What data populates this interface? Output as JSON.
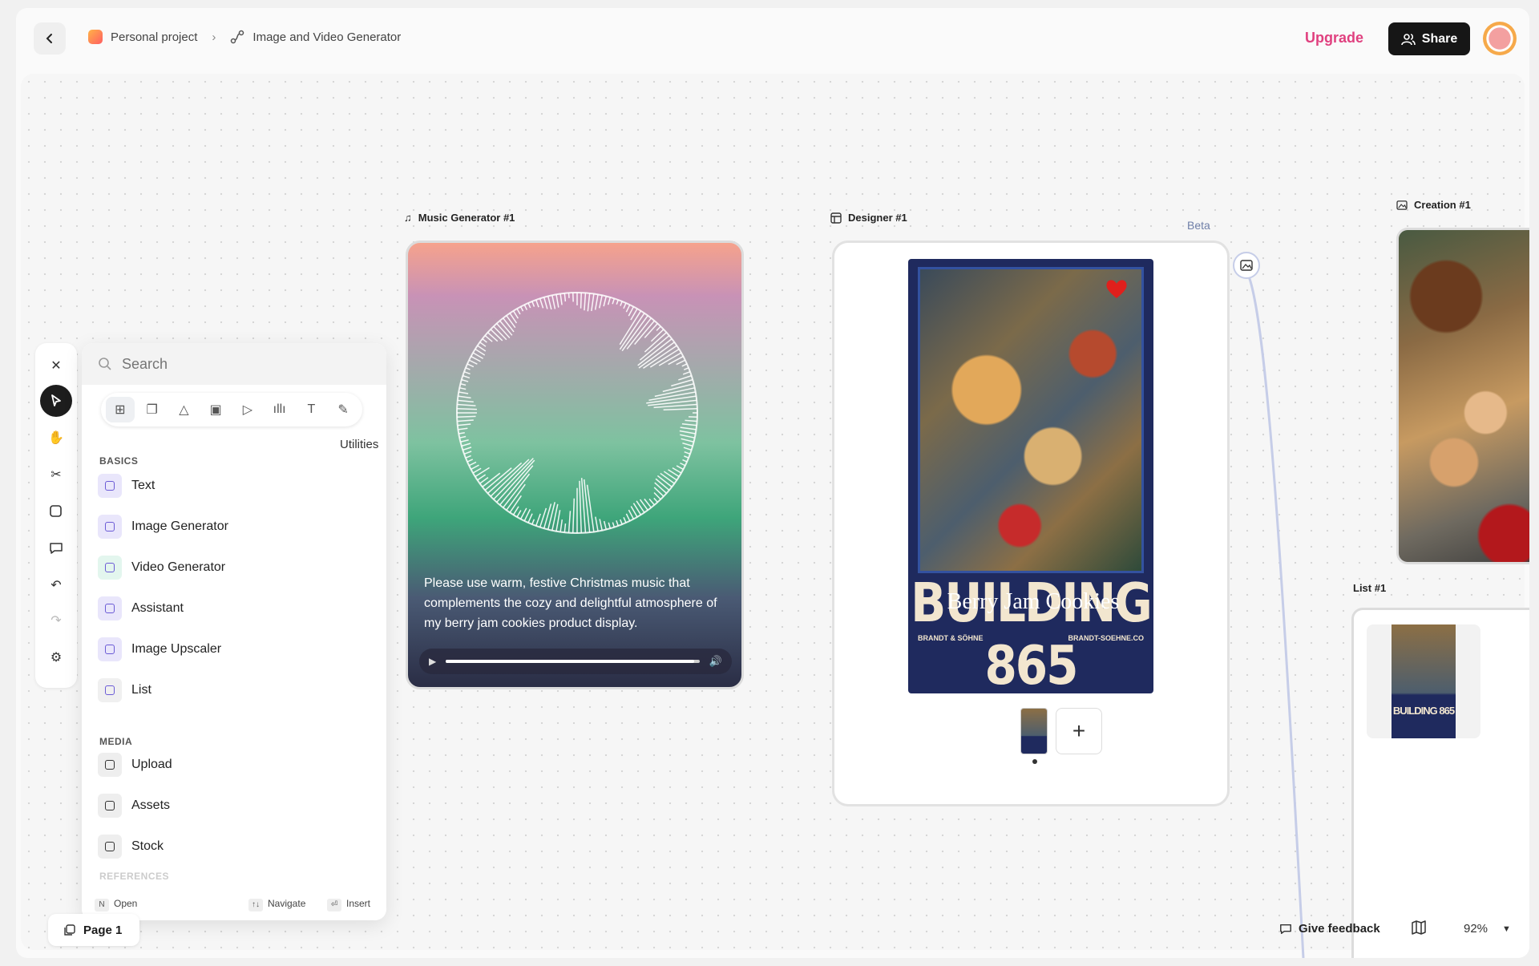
{
  "header": {
    "project": "Personal project",
    "page_name": "Image and Video Generator",
    "upgrade": "Upgrade",
    "share": "Share"
  },
  "toolbar": [
    "close-icon",
    "pointer-icon",
    "hand-icon",
    "scissors-icon",
    "sticky-note-icon",
    "comment-icon",
    "undo-icon",
    "redo-icon",
    "settings-icon"
  ],
  "panel": {
    "search_placeholder": "Search",
    "tooltip": "Utilities",
    "basics_label": "BASICS",
    "basics": [
      {
        "label": "Text",
        "icon": "text-icon",
        "color": "#e9e6fb"
      },
      {
        "label": "Image Generator",
        "icon": "image-icon",
        "color": "#e9e6fb"
      },
      {
        "label": "Video Generator",
        "icon": "video-icon",
        "color": "#e3f6ee"
      },
      {
        "label": "Assistant",
        "icon": "sparkle-icon",
        "color": "#e9e6fb"
      },
      {
        "label": "Image Upscaler",
        "icon": "upscale-icon",
        "color": "#e9e6fb"
      },
      {
        "label": "List",
        "icon": "list-icon",
        "color": "#f0f0f0"
      }
    ],
    "media_label": "MEDIA",
    "media": [
      {
        "label": "Upload",
        "icon": "upload-icon"
      },
      {
        "label": "Assets",
        "icon": "assets-icon"
      },
      {
        "label": "Stock",
        "icon": "search-icon"
      }
    ],
    "references_label": "REFERENCES",
    "footer": {
      "open_key": "N",
      "open": "Open",
      "navigate_key": "↑↓",
      "navigate": "Navigate",
      "insert_key": "⏎",
      "insert": "Insert"
    }
  },
  "music": {
    "title": "Music Generator #1",
    "prompt": "Please use warm, festive Christmas music that complements the cozy and delightful atmosphere of my berry jam cookies product display.",
    "progress": 0.98
  },
  "designer": {
    "title": "Designer #1",
    "badge": "Beta",
    "headline": "BUILDING 865",
    "overlay_text": "Berry Jam Cookies",
    "sub_left": "BRANDT & SÖHNE",
    "sub_right": "BRANDT-SOEHNE.CO"
  },
  "creation": {
    "title": "Creation #1"
  },
  "list": {
    "title": "List #1",
    "thumb_headline": "BUILDING 865"
  },
  "footer": {
    "page": "Page 1",
    "feedback": "Give feedback",
    "zoom": "92%"
  },
  "colors": {
    "accent": "#e0407f",
    "dark": "#161616",
    "connector": "#c6cde8"
  }
}
